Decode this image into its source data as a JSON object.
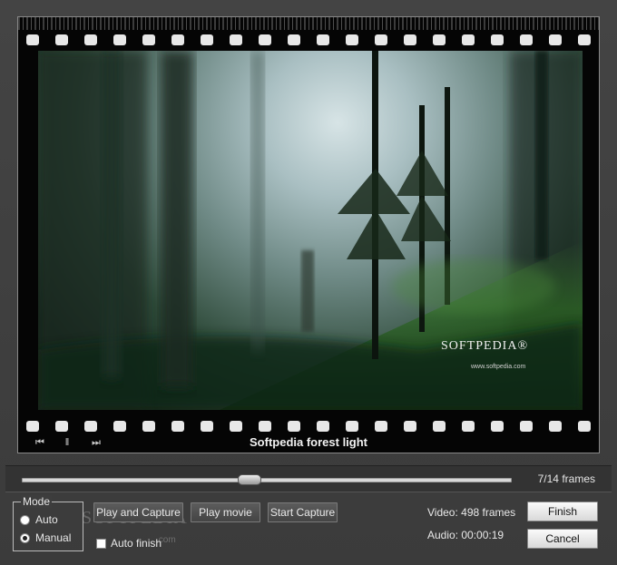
{
  "film": {
    "title": "Softpedia forest light",
    "watermark": "SOFTPEDIA®",
    "watermark_url": "www.softpedia.com",
    "prev_icon": "skip-back-icon",
    "pause_icon": "pause-icon",
    "next_icon": "skip-forward-icon",
    "prev_glyph": "⏮",
    "pause_glyph": "‖",
    "next_glyph": "⏭"
  },
  "timeline": {
    "frames_label": "7/14  frames",
    "current_frame": 7,
    "total_frames": 14
  },
  "mode": {
    "legend": "Mode",
    "options": [
      {
        "label": "Auto",
        "selected": false
      },
      {
        "label": "Manual",
        "selected": true
      }
    ]
  },
  "buttons": {
    "play_capture": "Play and Capture",
    "play_movie": "Play movie",
    "start_capture": "Start Capture",
    "finish": "Finish",
    "cancel": "Cancel"
  },
  "auto_finish": {
    "label": "Auto finish",
    "checked": false
  },
  "info": {
    "video": "Video: 498 frames",
    "audio": "Audio: 00:00:19"
  },
  "panel_watermark": {
    "text": "SOFTPEDIA",
    "url": ".com"
  }
}
